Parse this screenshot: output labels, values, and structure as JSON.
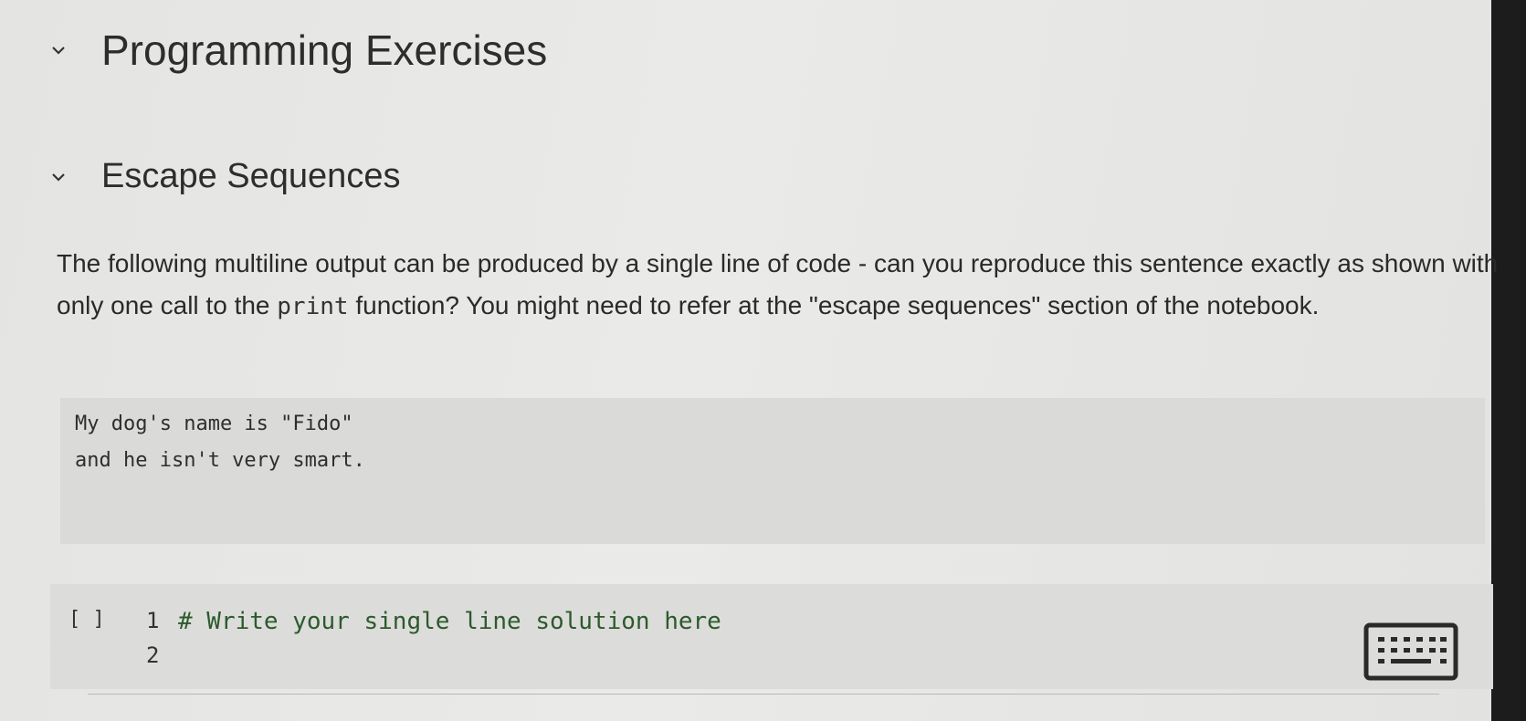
{
  "sections": {
    "main_title": "Programming Exercises",
    "sub_title": "Escape Sequences"
  },
  "description": {
    "part1": "The following multiline output can be produced by a single line of code - can you reproduce this sentence exactly as shown with only one call to the ",
    "code_word": "print",
    "part2": " function? You might need to refer at the \"escape sequences\" section of the notebook."
  },
  "output": {
    "line1": "My dog's name is \"Fido\"",
    "line2": "and he isn't very smart."
  },
  "code_cell": {
    "run_label": "[ ]",
    "line1_number": "1",
    "line1_code": "# Write your single line solution here",
    "line2_number": "2"
  },
  "icons": {
    "chevron": "chevron-down-icon",
    "keyboard": "keyboard-icon"
  }
}
